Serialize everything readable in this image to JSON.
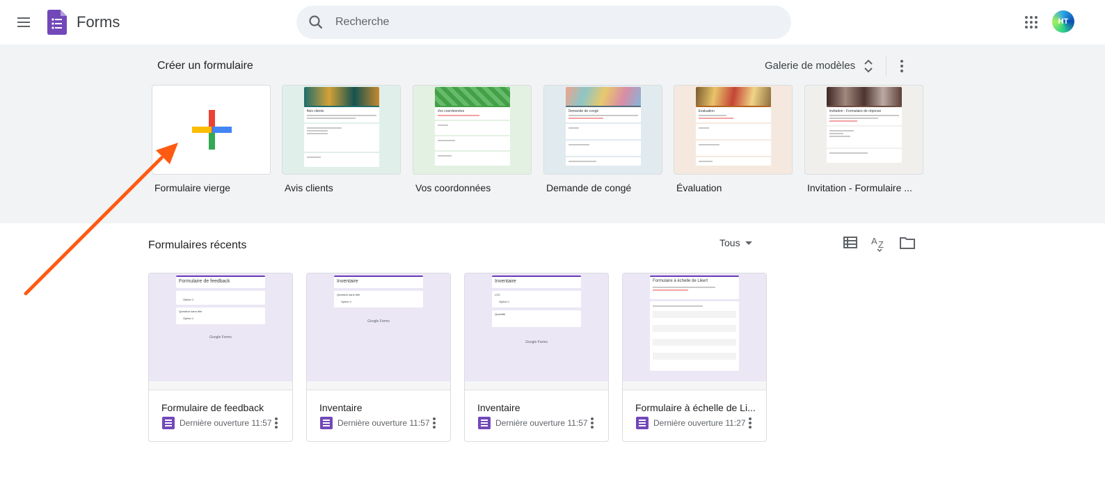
{
  "header": {
    "app_title": "Forms",
    "search_placeholder": "Recherche",
    "avatar_initials": "HT"
  },
  "gallery": {
    "title": "Créer un formulaire",
    "gallery_link": "Galerie de modèles",
    "templates": [
      {
        "label": "Formulaire vierge",
        "banner": "#ffffff"
      },
      {
        "label": "Avis clients",
        "banner": "#1f6e6a",
        "mini_title": "Avis clients"
      },
      {
        "label": "Vos coordonnées",
        "banner": "#4caf50",
        "mini_title": "Vos coordonnées"
      },
      {
        "label": "Demande de congé",
        "banner": "#e8a27c",
        "mini_title": "Demande de congé"
      },
      {
        "label": "Évaluation",
        "banner": "#d8a14a",
        "mini_title": "Évaluation"
      },
      {
        "label": "Invitation - Formulaire ...",
        "banner": "#6d4c41",
        "mini_title": "Invitation - Formulaire de réponse"
      }
    ]
  },
  "recent": {
    "title": "Formulaires récents",
    "owner_filter": "Tous",
    "forms": [
      {
        "name": "Formulaire de feedback",
        "meta": "Dernière ouverture 11:57",
        "thumb_title": "Formulaire de feedback",
        "q1": "Option 1",
        "q2": "Question sans titre",
        "q3": "Option 1"
      },
      {
        "name": "Inventaire",
        "meta": "Dernière ouverture 11:57",
        "thumb_title": "Inventaire",
        "q1": "Question sans titre",
        "q2": "Option 1",
        "q3": ""
      },
      {
        "name": "Inventaire",
        "meta": "Dernière ouverture 11:57",
        "thumb_title": "Inventaire",
        "q1": "LO2",
        "q2": "Option 1",
        "q3": "Quantité"
      },
      {
        "name": "Formulaire à échelle de Li...",
        "meta": "Dernière ouverture 11:27",
        "thumb_title": "Formulaire à échelle de Likert",
        "q1": "",
        "q2": "",
        "q3": ""
      }
    ],
    "footer_brand": "Google Forms"
  },
  "colors": {
    "accent": "#673ab7",
    "annotation_arrow": "#ff5a12",
    "forms_icon": "#7248b9"
  }
}
